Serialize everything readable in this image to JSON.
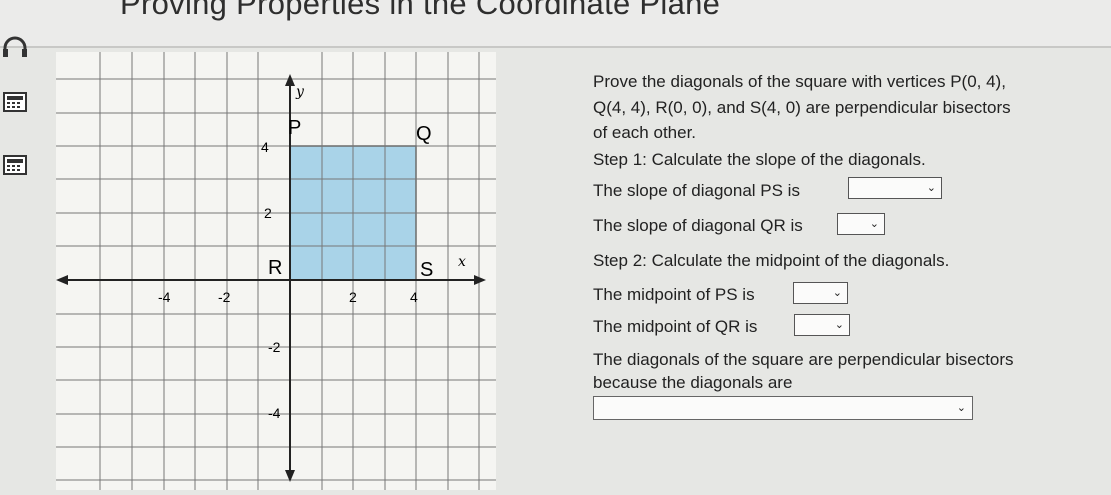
{
  "header": {
    "title": "Proving Properties in the Coordinate Plane"
  },
  "graph": {
    "axis_x_label": "x",
    "axis_y_label": "y",
    "x_ticks": [
      "-4",
      "-2",
      "2",
      "4"
    ],
    "y_ticks": [
      "4",
      "2",
      "-2",
      "-4"
    ],
    "points": {
      "P": "P",
      "Q": "Q",
      "R": "R",
      "S": "S"
    },
    "square_fill": "#a9d3e8",
    "square_stroke": "#555555"
  },
  "question": {
    "intro_line1": "Prove the diagonals of the square with vertices P(0, 4),",
    "intro_line2": "Q(4, 4), R(0, 0), and S(4, 0) are perpendicular bisectors",
    "intro_line3": "of each other.",
    "step1": "Step 1: Calculate the slope of the diagonals.",
    "slope_ps": "The slope of diagonal PS is",
    "slope_qr": "The slope of diagonal QR is",
    "step2": "Step 2: Calculate the midpoint of the diagonals.",
    "mid_ps": "The midpoint of PS is",
    "mid_qr": "The midpoint of QR is",
    "conclusion_line1": "The diagonals of the square are perpendicular bisectors",
    "conclusion_line2": "because the diagonals are"
  },
  "dropdowns": {
    "chevron": "⌄"
  }
}
